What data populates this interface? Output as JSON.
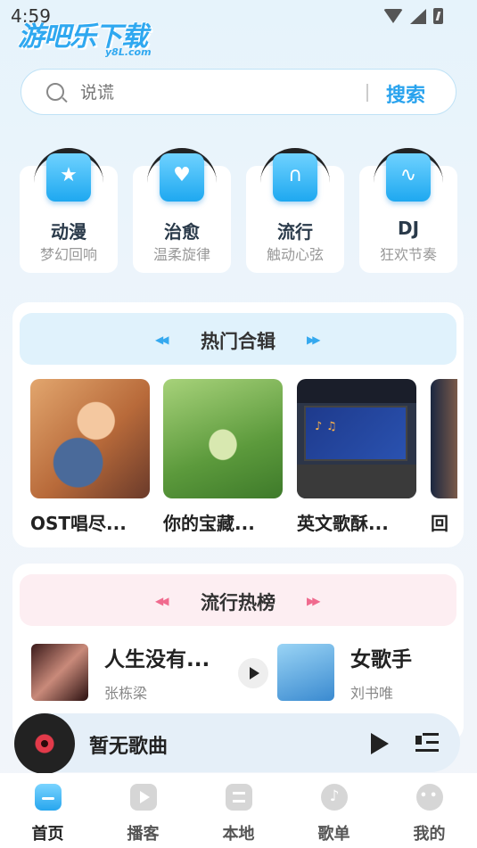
{
  "status_bar": {
    "time": "4:59"
  },
  "watermark": {
    "text": "游吧乐下载",
    "sub": "y8L.com"
  },
  "search": {
    "placeholder": "说谎",
    "button": "搜索"
  },
  "categories": [
    {
      "title": "动漫",
      "subtitle": "梦幻回响",
      "icon": "star-bookmark-icon"
    },
    {
      "title": "治愈",
      "subtitle": "温柔旋律",
      "icon": "heart-shield-icon"
    },
    {
      "title": "流行",
      "subtitle": "触动心弦",
      "icon": "headphones-icon"
    },
    {
      "title": "DJ",
      "subtitle": "狂欢节奏",
      "icon": "waveform-icon"
    }
  ],
  "hot_albums": {
    "title": "热门合辑",
    "items": [
      {
        "name": "OST唱尽..."
      },
      {
        "name": "你的宝藏..."
      },
      {
        "name": "英文歌酥..."
      },
      {
        "name": "回"
      }
    ]
  },
  "popular_chart": {
    "title": "流行热榜",
    "songs": [
      {
        "title": "人生没有...",
        "artist": "张栋梁"
      },
      {
        "title": "女歌手",
        "artist": "刘书唯"
      }
    ]
  },
  "player": {
    "title": "暂无歌曲"
  },
  "nav": [
    {
      "label": "首页",
      "icon": "home-icon",
      "active": true
    },
    {
      "label": "播客",
      "icon": "podcast-icon",
      "active": false
    },
    {
      "label": "本地",
      "icon": "local-icon",
      "active": false
    },
    {
      "label": "歌单",
      "icon": "playlist-icon",
      "active": false
    },
    {
      "label": "我的",
      "icon": "profile-icon",
      "active": false
    }
  ],
  "colors": {
    "accent": "#29a3ee",
    "pink_accent": "#f06a8e",
    "hot_head_bg": "#e0f2fc",
    "pop_head_bg": "#fdeef2"
  }
}
